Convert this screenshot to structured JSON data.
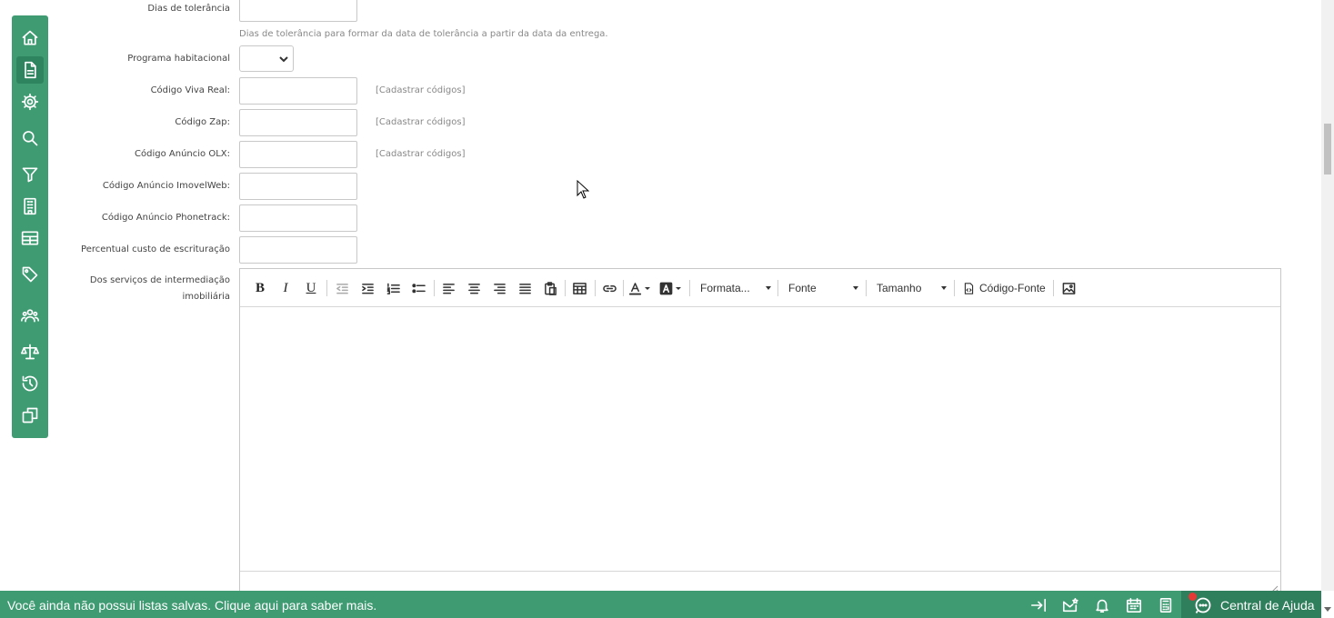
{
  "sidenav": {
    "items": [
      {
        "icon": "home-icon"
      },
      {
        "icon": "document-icon",
        "active": true
      },
      {
        "icon": "gear-icon"
      },
      {
        "icon": "search-icon"
      },
      {
        "icon": "filter-icon"
      },
      {
        "icon": "building-icon"
      },
      {
        "icon": "table-icon"
      },
      {
        "icon": "tag-icon"
      },
      {
        "icon": "users-icon"
      },
      {
        "icon": "scale-icon"
      },
      {
        "icon": "history-icon"
      },
      {
        "icon": "copy-icon"
      }
    ]
  },
  "form": {
    "tolerance_days": {
      "label": "Dias de tolerância",
      "value": "",
      "help": "Dias de tolerância para formar da data de tolerância a partir da data da entrega."
    },
    "housing_program": {
      "label": "Programa habitacional",
      "value": ""
    },
    "viva_real_code": {
      "label": "Código Viva Real:",
      "value": "",
      "link": "[Cadastrar códigos]"
    },
    "zap_code": {
      "label": "Código Zap:",
      "value": "",
      "link": "[Cadastrar códigos]"
    },
    "olx_code": {
      "label": "Código Anúncio OLX:",
      "value": "",
      "link": "[Cadastrar códigos]"
    },
    "imovelweb_code": {
      "label": "Código Anúncio ImovelWeb:",
      "value": ""
    },
    "phonetrack_code": {
      "label": "Código Anúncio Phonetrack:",
      "value": ""
    },
    "bookkeeping_cost": {
      "label": "Percentual custo de escrituração",
      "value": ""
    },
    "brokerage_services": {
      "label": "Dos serviços de intermediação imobiliária"
    }
  },
  "editor": {
    "format_label": "Formata...",
    "font_label": "Fonte",
    "size_label": "Tamanho",
    "source_label": "Código-Fonte",
    "bold": "B",
    "italic": "I",
    "underline": "U",
    "content": ""
  },
  "bottombar": {
    "message": "Você ainda não possui listas salvas. Clique aqui para saber mais.",
    "help_center": "Central de Ajuda",
    "icons": [
      "collapse-right-icon",
      "mail-icon",
      "bell-icon",
      "calendar-icon",
      "calculator-icon",
      "chat-icon"
    ]
  },
  "colors": {
    "accent": "#3e9b72",
    "accent_dark": "#2f7f5c",
    "notification": "#e53935"
  }
}
